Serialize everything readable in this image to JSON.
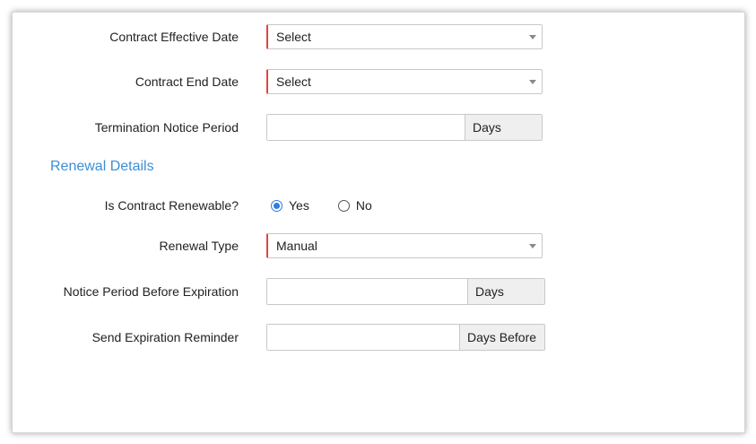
{
  "form": {
    "contract_effective_date": {
      "label": "Contract Effective Date",
      "value": "Select"
    },
    "contract_end_date": {
      "label": "Contract End Date",
      "value": "Select"
    },
    "termination_notice_period": {
      "label": "Termination Notice Period",
      "value": "",
      "unit": "Days"
    }
  },
  "renewal": {
    "section_title": "Renewal Details",
    "is_renewable": {
      "label": "Is Contract Renewable?",
      "options": [
        {
          "label": "Yes",
          "checked": true
        },
        {
          "label": "No",
          "checked": false
        }
      ]
    },
    "renewal_type": {
      "label": "Renewal Type",
      "value": "Manual"
    },
    "notice_period_before_expiration": {
      "label": "Notice Period Before Expiration",
      "value": "",
      "unit": "Days"
    },
    "send_expiration_reminder": {
      "label": "Send Expiration Reminder",
      "value": "",
      "unit": "Days Before"
    }
  },
  "colors": {
    "required_marker": "#e0453d",
    "section_title": "#3d8fd6",
    "radio_checked": "#2f7de1"
  },
  "icons": {
    "dropdown": "caret-down-icon"
  }
}
